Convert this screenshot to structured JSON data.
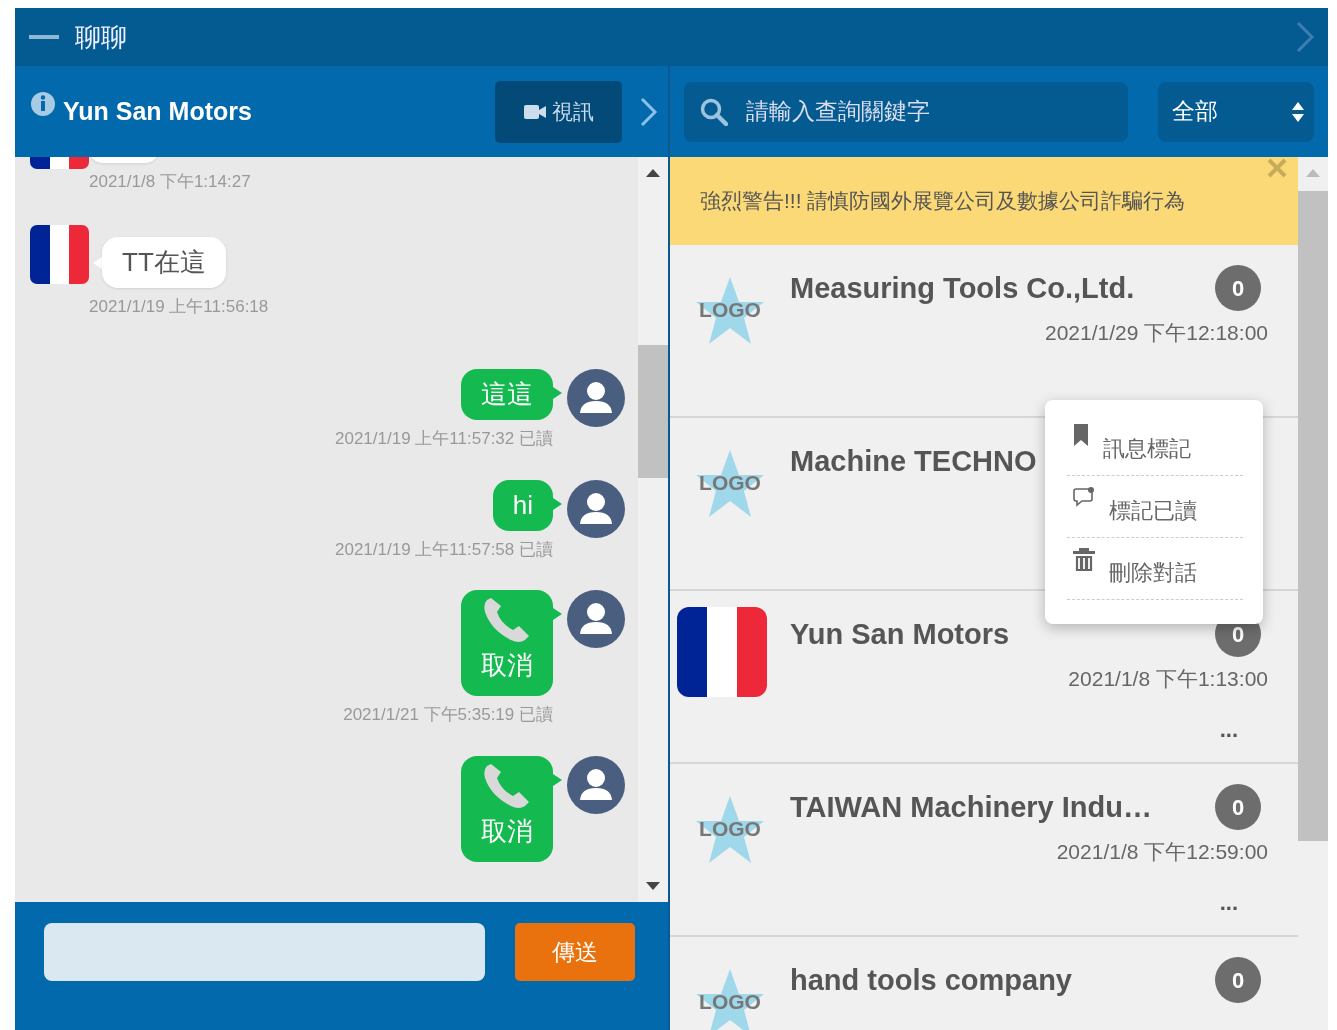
{
  "window": {
    "title": "聊聊"
  },
  "chat": {
    "contact": "Yun San Motors",
    "video_button": "視訊",
    "messages": [
      {
        "kind": "incoming_cut",
        "time": "2021/1/8 下午1:14:27"
      },
      {
        "kind": "incoming_text",
        "text": "TT在這",
        "time": "2021/1/19 上午11:56:18"
      },
      {
        "kind": "outgoing_text",
        "text": "這這",
        "time": "2021/1/19 上午11:57:32 已讀"
      },
      {
        "kind": "outgoing_text",
        "text": "hi",
        "time": "2021/1/19 上午11:57:58 已讀"
      },
      {
        "kind": "outgoing_call",
        "text": "取消",
        "time": "2021/1/21 下午5:35:19 已讀"
      },
      {
        "kind": "outgoing_call",
        "text": "取消"
      }
    ],
    "send_button": "傳送"
  },
  "search": {
    "placeholder": "請輸入查詢關鍵字",
    "filter": "全部"
  },
  "warning": "強烈警告!!! 請慎防國外展覽公司及數據公司詐騙行為",
  "conversations": [
    {
      "kind": "logo",
      "logo_text": "LOGO",
      "name": "Measuring Tools Co.,Ltd.",
      "unread": "0",
      "time": "2021/1/29 下午12:18:00"
    },
    {
      "kind": "logo",
      "logo_text": "LOGO",
      "name": "Machine TECHNO"
    },
    {
      "kind": "flag",
      "name": "Yun San Motors",
      "unread": "0",
      "time": "2021/1/8 下午1:13:00",
      "more": "..."
    },
    {
      "kind": "logo",
      "logo_text": "LOGO",
      "name": "TAIWAN Machinery Indu…",
      "unread": "0",
      "time": "2021/1/8 下午12:59:00",
      "more": "..."
    },
    {
      "kind": "logo",
      "logo_text": "LOGO",
      "name": "hand tools company",
      "unread": "0"
    }
  ],
  "context_menu": [
    {
      "kind": "bookmark",
      "label": "訊息標記"
    },
    {
      "kind": "read",
      "label": "標記已讀"
    },
    {
      "kind": "delete",
      "label": "刪除對話"
    }
  ]
}
